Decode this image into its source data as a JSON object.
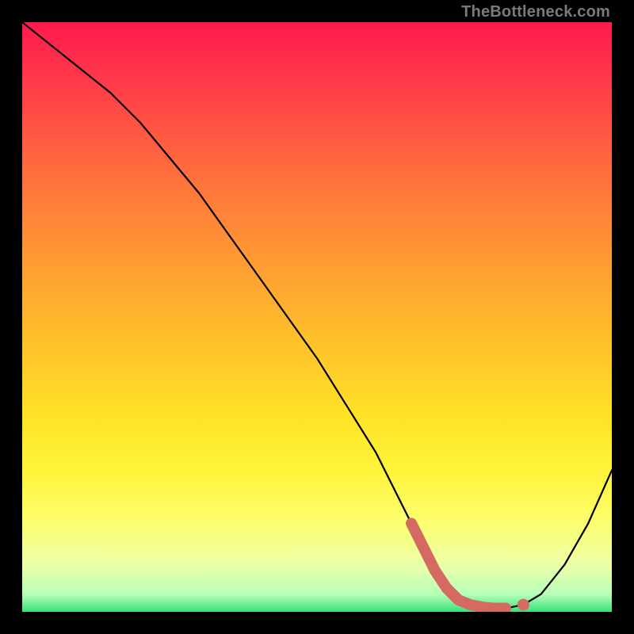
{
  "watermark": "TheBottleneck.com",
  "colors": {
    "curve": "#000000",
    "highlight": "#d46a62",
    "bg_top": "#ff1a4d",
    "bg_bottom": "#38e27a"
  },
  "chart_data": {
    "type": "line",
    "title": "",
    "xlabel": "",
    "ylabel": "",
    "xlim": [
      0,
      100
    ],
    "ylim": [
      0,
      100
    ],
    "grid": false,
    "legend": false,
    "series": [
      {
        "name": "bottleneck_curve",
        "x": [
          0,
          5,
          10,
          15,
          20,
          25,
          30,
          35,
          40,
          45,
          50,
          55,
          60,
          63,
          66,
          68,
          70,
          72,
          74,
          76,
          78,
          80,
          82,
          85,
          88,
          92,
          96,
          100
        ],
        "y": [
          100,
          96,
          92,
          88,
          83,
          77,
          71,
          64,
          57,
          50,
          43,
          35,
          27,
          21,
          15,
          11,
          7,
          4,
          2,
          1.2,
          0.8,
          0.6,
          0.6,
          1.2,
          3,
          8,
          15,
          24
        ]
      },
      {
        "name": "optimal_zone",
        "x": [
          66,
          68,
          70,
          72,
          74,
          76,
          78,
          80,
          82
        ],
        "y": [
          15,
          11,
          7,
          4,
          2,
          1.2,
          0.8,
          0.6,
          0.6
        ]
      }
    ],
    "optimal_end_point": {
      "x": 85,
      "y": 1.2
    }
  }
}
